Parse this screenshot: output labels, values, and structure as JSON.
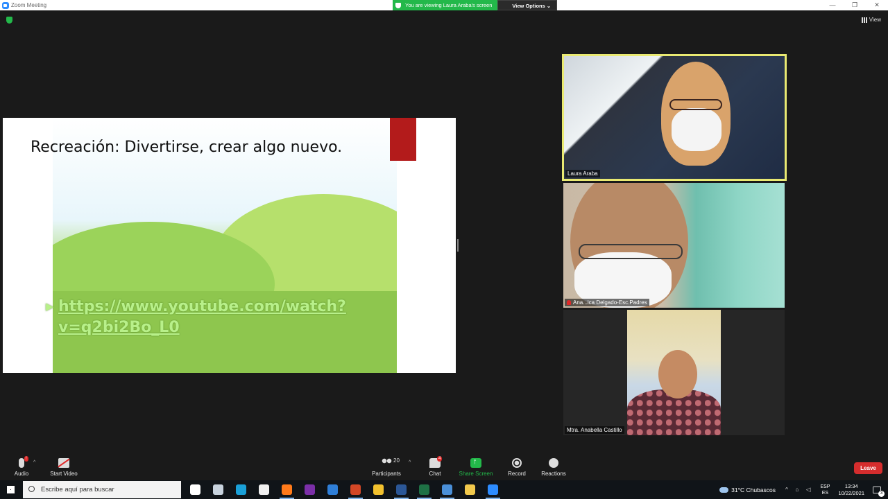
{
  "window": {
    "title": "Zoom Meeting",
    "controls": [
      "—",
      "❐",
      "✕"
    ]
  },
  "share_banner": {
    "viewing_text": "You are viewing Laura Araba's screen",
    "view_options_label": "View Options ⌄"
  },
  "view_button": {
    "label": "View"
  },
  "slide": {
    "heading": "Recreación: Divertirse, crear algo nuevo.",
    "link": "https://www.youtube.com/watch?v=q2bi2Bo_L0"
  },
  "participants": [
    {
      "name": "Laura Araba",
      "muted": false,
      "active_speaker": true
    },
    {
      "name": "Ana...ica Delgado-Esc.Padres",
      "muted": true,
      "active_speaker": false
    },
    {
      "name": "Mtra. Anabella Castillo",
      "muted": false,
      "active_speaker": false
    }
  ],
  "toolbar": {
    "audio": {
      "label": "Audio",
      "badge": "!"
    },
    "video": {
      "label": "Start Video"
    },
    "participants": {
      "label": "Participants",
      "count": "20"
    },
    "chat": {
      "label": "Chat",
      "badge": "4"
    },
    "share": {
      "label": "Share Screen"
    },
    "record": {
      "label": "Record"
    },
    "reactions": {
      "label": "Reactions"
    },
    "leave": {
      "label": "Leave"
    }
  },
  "taskbar": {
    "search_placeholder": "Escribe aquí para buscar",
    "weather": "31°C  Chubascos",
    "lang_top": "ESP",
    "lang_bottom": "ES",
    "time": "13:34",
    "date": "10/22/2021",
    "notification_count": "3",
    "apps": [
      {
        "name": "task-view",
        "color": "#ffffff"
      },
      {
        "name": "people-app",
        "color": "#c8d3de"
      },
      {
        "name": "edge",
        "color": "#1aa0d8"
      },
      {
        "name": "store",
        "color": "#f0f0f0"
      },
      {
        "name": "firefox",
        "color": "#ff7a1a"
      },
      {
        "name": "onenote",
        "color": "#7b2fa8"
      },
      {
        "name": "mail",
        "color": "#2f7fd8"
      },
      {
        "name": "powerpoint",
        "color": "#d24726"
      },
      {
        "name": "chrome",
        "color": "#f2c12e"
      },
      {
        "name": "word",
        "color": "#2b5797"
      },
      {
        "name": "excel",
        "color": "#1e7145"
      },
      {
        "name": "chrome-profile",
        "color": "#4a90d9"
      },
      {
        "name": "file-explorer",
        "color": "#f2c94c"
      },
      {
        "name": "zoom",
        "color": "#2d8cff"
      }
    ]
  },
  "colors": {
    "accent": "#2d8cff",
    "share_green": "#23b84a",
    "leave_red": "#d62d2d",
    "active_speaker_border": "#e9e972"
  }
}
